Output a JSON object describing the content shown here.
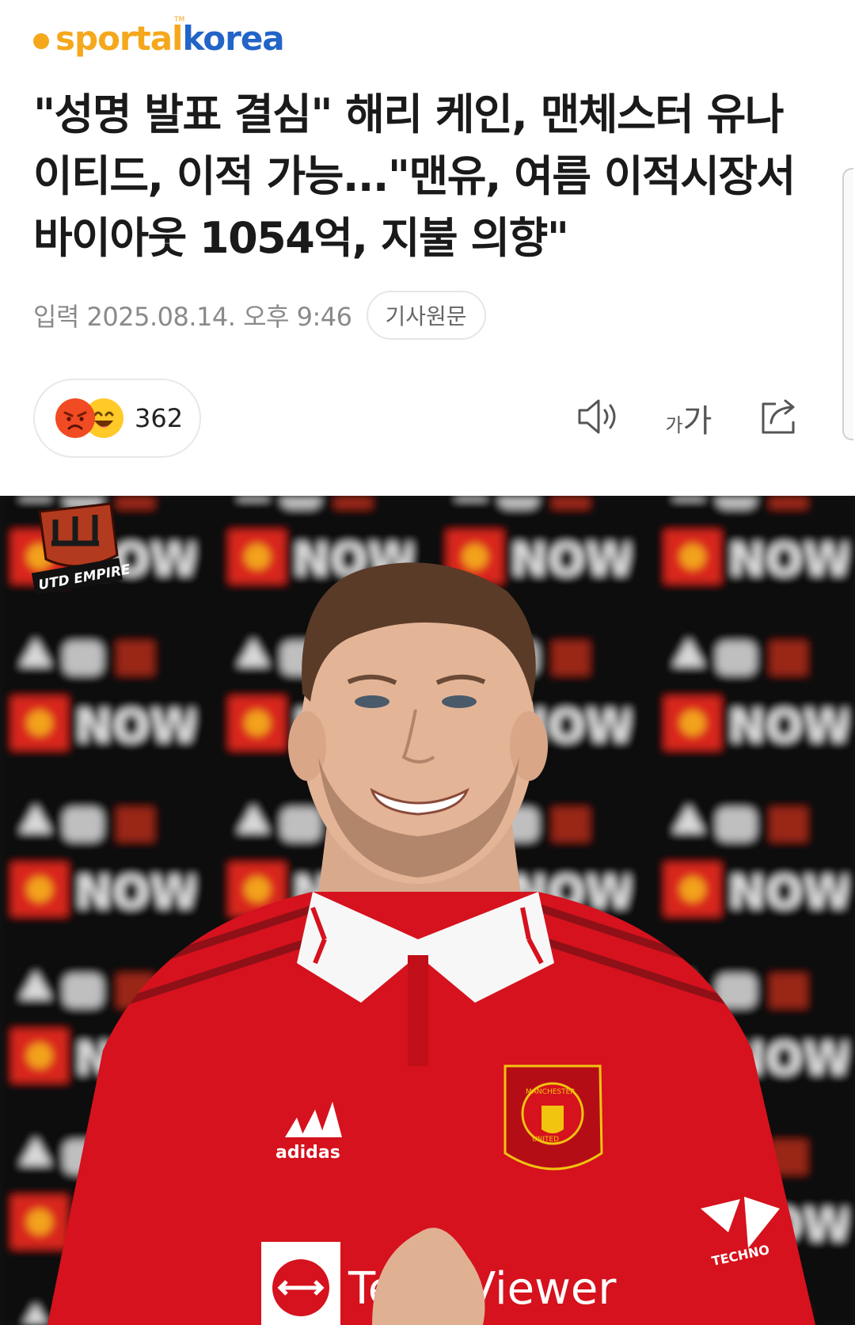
{
  "brand": {
    "part1": "sportal",
    "part2": "korea",
    "tm": "TM"
  },
  "article": {
    "headline": "\"성명 발표 결심\" 해리 케인, 맨체스터 유나이티드, 이적 가능...\"맨유, 여름 이적시장서 바이아웃 1054억, 지불 의향\"",
    "published": "입력 2025.08.14. 오후 9:46",
    "source_button": "기사원문"
  },
  "reactions": {
    "count": "362",
    "icons": [
      "angry-emoji",
      "laughing-emoji"
    ]
  },
  "toolbar": {
    "font_small": "가",
    "font_big": "가",
    "icons": [
      "speaker-icon",
      "font-size-icon",
      "share-icon"
    ]
  },
  "photo": {
    "watermark": "UTD EMPIRE",
    "backdrop_text": "NOW",
    "kit_brand": "adidas",
    "sponsor": "TeamViewer",
    "sleeve_sponsor": "TECHNO",
    "crest_top": "MANCHESTER",
    "crest_bottom": "UNITED"
  },
  "colors": {
    "brand_orange": "#f5a81c",
    "brand_blue": "#2264c8",
    "shirt_red": "#d5121d"
  }
}
